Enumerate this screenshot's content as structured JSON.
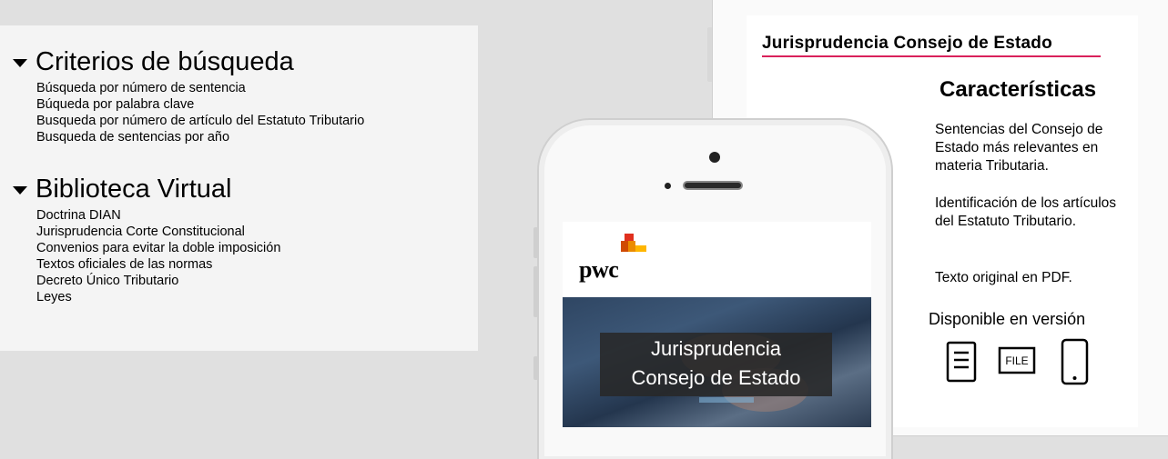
{
  "menu": {
    "sections": [
      {
        "title": "Criterios de búsqueda",
        "links": [
          "Búsqueda por número de sentencia",
          "Búqueda por palabra clave",
          "Busqueda por número de artículo del Estatuto Tributario",
          "Busqueda de sentencias por año"
        ]
      },
      {
        "title": "Biblioteca Virtual",
        "links": [
          "Doctrina DIAN",
          "Jurisprudencia Corte Constitucional",
          "Convenios para evitar la doble imposición",
          "Textos oficiales de las normas",
          "Decreto Único Tributario",
          "Leyes"
        ]
      }
    ]
  },
  "tablet": {
    "title": "Jurisprudencia Consejo de Estado",
    "features_heading": "Características",
    "features": [
      "Sentencias del Consejo de Estado más relevantes en materia Tributaria.",
      "Identificación de los artículos del Estatuto Tributario.",
      "Texto original en PDF."
    ],
    "available_label": "Disponible en versión",
    "file_icon_label": "FILE",
    "icons": [
      "document-icon",
      "file-icon",
      "mobile-icon"
    ],
    "accent_color": "#d9215b"
  },
  "phone": {
    "logo_text": "pwc",
    "caption_line1": "Jurisprudencia",
    "caption_line2": "Consejo de Estado",
    "logo_colors": [
      "#e0301e",
      "#eb8c00",
      "#ffb600",
      "#d04a02"
    ]
  }
}
